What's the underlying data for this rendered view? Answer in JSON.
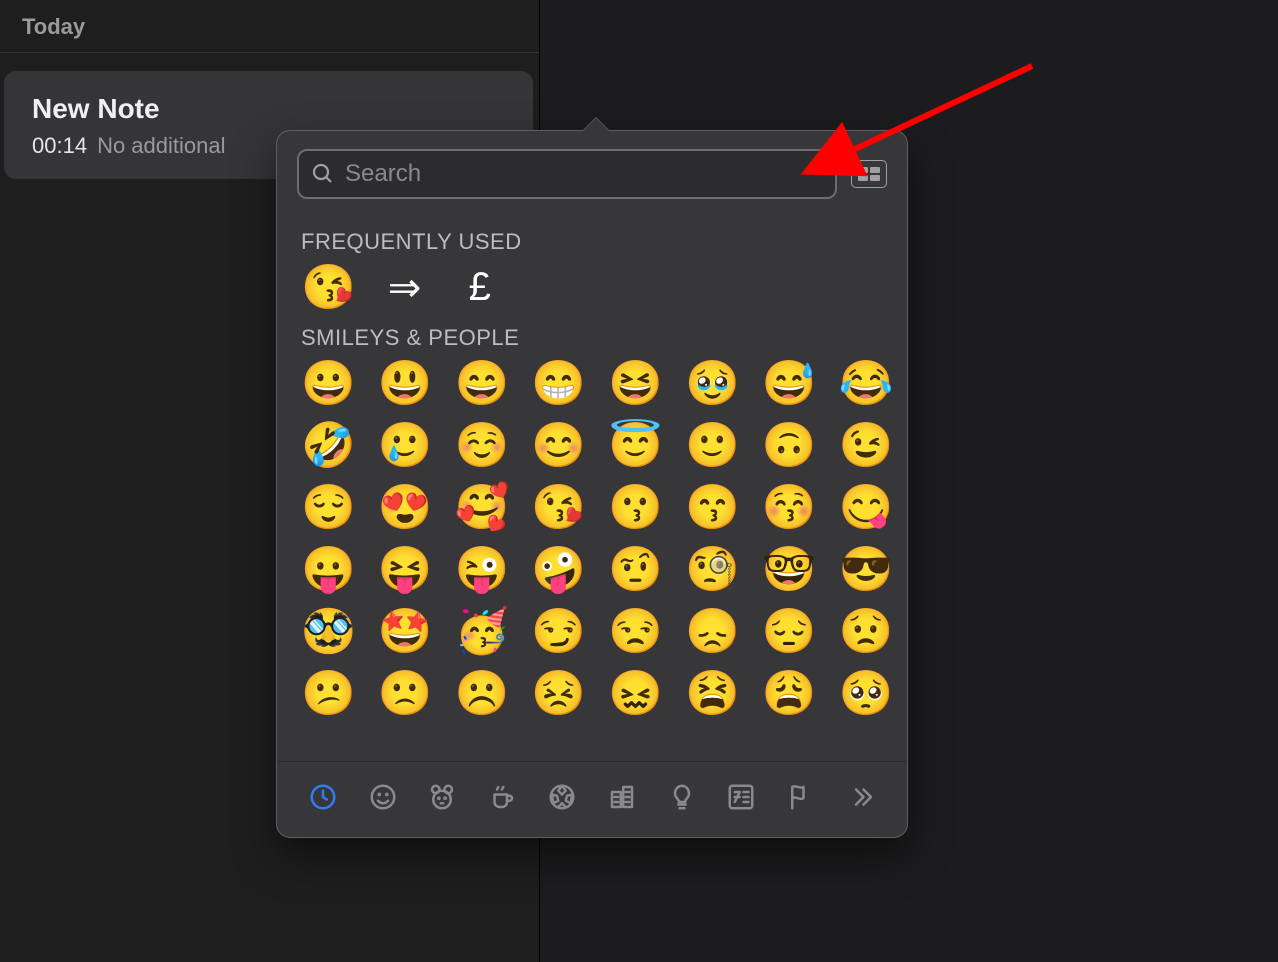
{
  "sidebar": {
    "section_label": "Today",
    "note": {
      "title": "New Note",
      "time": "00:14",
      "preview": "No additional"
    }
  },
  "picker": {
    "search_placeholder": "Search",
    "frequently_used_label": "FREQUENTLY USED",
    "frequently_used": [
      "😘",
      "⇒",
      "£"
    ],
    "smileys_label": "SMILEYS & PEOPLE",
    "smileys": [
      "😀",
      "😃",
      "😄",
      "😁",
      "😆",
      "🥹",
      "😅",
      "😂",
      "🤣",
      "🥲",
      "☺️",
      "😊",
      "😇",
      "🙂",
      "🙃",
      "😉",
      "😌",
      "😍",
      "🥰",
      "😘",
      "😗",
      "😙",
      "😚",
      "😋",
      "😛",
      "😝",
      "😜",
      "🤪",
      "🤨",
      "🧐",
      "🤓",
      "😎",
      "🥸",
      "🤩",
      "🥳",
      "😏",
      "😒",
      "😞",
      "😔",
      "😟",
      "😕",
      "🙁",
      "☹️",
      "😣",
      "😖",
      "😫",
      "😩",
      "🥺"
    ],
    "categories": [
      {
        "name": "frequently-used",
        "icon": "clock",
        "active": true
      },
      {
        "name": "smileys-people",
        "icon": "smiley",
        "active": false
      },
      {
        "name": "animals-nature",
        "icon": "bear",
        "active": false
      },
      {
        "name": "food-drink",
        "icon": "cup",
        "active": false
      },
      {
        "name": "activity",
        "icon": "soccer",
        "active": false
      },
      {
        "name": "travel-places",
        "icon": "building",
        "active": false
      },
      {
        "name": "objects",
        "icon": "bulb",
        "active": false
      },
      {
        "name": "symbols",
        "icon": "symbols",
        "active": false
      },
      {
        "name": "flags",
        "icon": "flag",
        "active": false
      },
      {
        "name": "more",
        "icon": "more",
        "active": false
      }
    ]
  },
  "annotation": {
    "arrow_color": "#ff0000"
  }
}
